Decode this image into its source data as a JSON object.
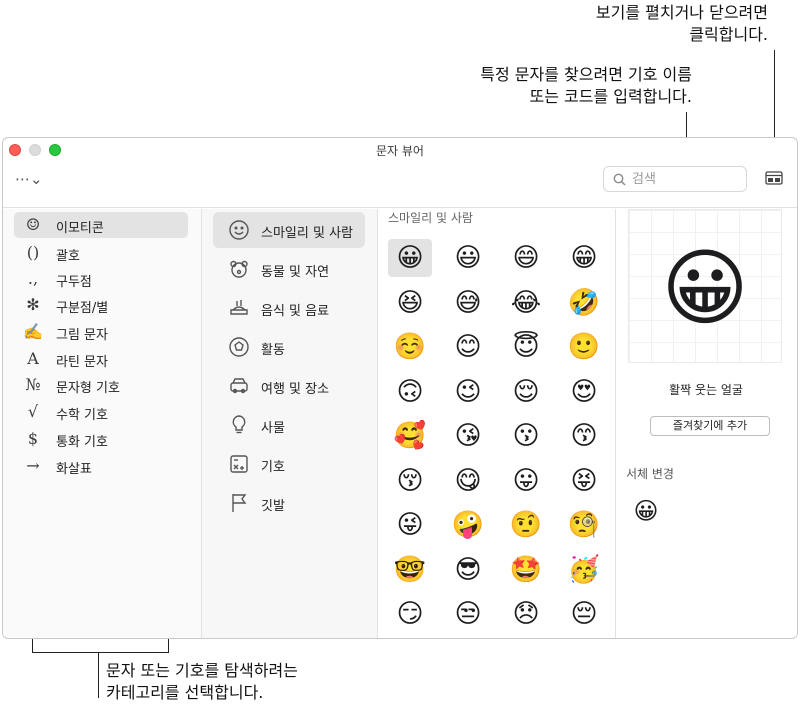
{
  "callouts": {
    "toggle_view": "보기를 펼치거나 닫으려면\n클릭합니다.",
    "search_help": "특정 문자를 찾으려면 기호 이름\n또는 코드를 입력합니다.",
    "category_help": "문자 또는 기호를 탐색하려는\n카테고리를 선택합니다."
  },
  "window": {
    "title": "문자 뷰어"
  },
  "toolbar": {
    "more_glyph": "⋯⌄",
    "search_placeholder": "검색"
  },
  "sidebar": {
    "items": [
      {
        "icon": "☺",
        "icon_name": "emoji-icon",
        "label": "이모티콘",
        "selected": true
      },
      {
        "icon": "()",
        "icon_name": "parentheses-icon",
        "label": "괄호"
      },
      {
        "icon": ".,",
        "icon_name": "punctuation-icon",
        "label": "구두점"
      },
      {
        "icon": "✻",
        "icon_name": "asterisk-icon",
        "label": "구분점/별"
      },
      {
        "icon": "✍",
        "icon_name": "pictograph-icon",
        "label": "그림 문자"
      },
      {
        "icon": "A",
        "icon_name": "latin-letter-icon",
        "label": "라틴 문자"
      },
      {
        "icon": "№",
        "icon_name": "numero-icon",
        "label": "문자형 기호"
      },
      {
        "icon": "√",
        "icon_name": "square-root-icon",
        "label": "수학 기호"
      },
      {
        "icon": "$",
        "icon_name": "dollar-icon",
        "label": "통화 기호"
      },
      {
        "icon": "→",
        "icon_name": "arrow-icon",
        "label": "화살표"
      }
    ]
  },
  "categories": {
    "items": [
      {
        "icon_name": "smiley-icon",
        "label": "스마일리 및 사람",
        "selected": true
      },
      {
        "icon_name": "bear-icon",
        "label": "동물 및 자연"
      },
      {
        "icon_name": "food-icon",
        "label": "음식 및 음료"
      },
      {
        "icon_name": "ball-icon",
        "label": "활동"
      },
      {
        "icon_name": "car-icon",
        "label": "여행 및 장소"
      },
      {
        "icon_name": "lightbulb-icon",
        "label": "사물"
      },
      {
        "icon_name": "symbols-icon",
        "label": "기호"
      },
      {
        "icon_name": "flag-icon",
        "label": "깃발"
      }
    ]
  },
  "grid": {
    "title": "스마일리 및 사람",
    "emojis": [
      "😀",
      "😃",
      "😄",
      "😁",
      "😆",
      "😅",
      "😂",
      "🤣",
      "☺️",
      "😊",
      "😇",
      "🙂",
      "🙃",
      "😉",
      "😌",
      "😍",
      "🥰",
      "😘",
      "😗",
      "😙",
      "😚",
      "😋",
      "😛",
      "😝",
      "😜",
      "🤪",
      "🤨",
      "🧐",
      "🤓",
      "😎",
      "🤩",
      "🥳",
      "😏",
      "😒",
      "😞",
      "😔"
    ],
    "selected_index": 0
  },
  "detail": {
    "preview": "😀",
    "name": "활짝 웃는 얼굴",
    "favorite_button": "즐겨찾기에 추가",
    "variants_title": "서체 변경",
    "variants": [
      "😀"
    ]
  }
}
